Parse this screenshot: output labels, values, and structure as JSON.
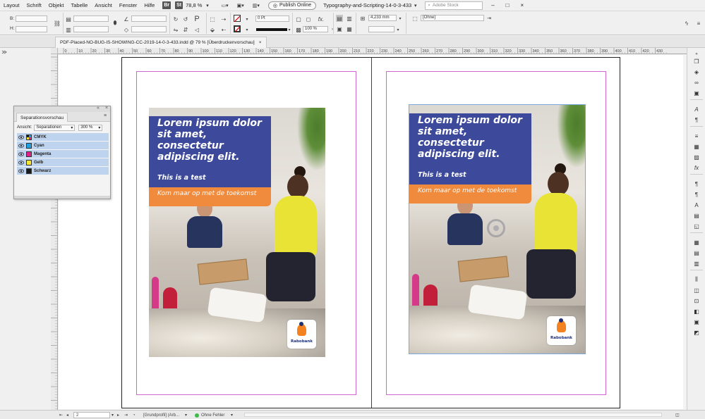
{
  "menu": {
    "items": [
      "Layout",
      "Schrift",
      "Objekt",
      "Tabelle",
      "Ansicht",
      "Fenster",
      "Hilfe"
    ],
    "br_label": "Br",
    "st_label": "St",
    "zoom": "78,8 %",
    "publish_label": "Publish Online",
    "workspace": "Typography-and-Scripting-14-0-3-433",
    "stock_placeholder": "Adobe Stock",
    "win_min": "–",
    "win_max": "□",
    "win_close": "×"
  },
  "control": {
    "b_label": "B:",
    "h_label": "H:",
    "stroke_weight": "0 Pt",
    "opacity": "100 %",
    "offset": "4,233 mm",
    "object_style": "[Ohne]"
  },
  "tab": {
    "title": "PDF-Placed-NO-BUG-IS-SHOWING-CC-2019-14-0-3-433.indd @ 79 % [Überdruckenvorschau]",
    "close": "×"
  },
  "ruler": {
    "h_ticks": [
      "0",
      "10",
      "20",
      "30",
      "40",
      "50",
      "60",
      "70",
      "80",
      "90",
      "100",
      "110",
      "120",
      "130",
      "140",
      "150",
      "160",
      "170",
      "180",
      "190",
      "200",
      "210",
      "220",
      "230",
      "240",
      "250",
      "260",
      "270",
      "280",
      "290",
      "300",
      "310",
      "320",
      "330",
      "340",
      "350",
      "360",
      "370",
      "380",
      "390",
      "400",
      "410",
      "420",
      "430"
    ]
  },
  "page": {
    "headline": "Lorem ipsum dolor sit amet, consectetur adipiscing elit.",
    "subline": "This is a test",
    "tagline": "Kom maar op met de toekomst",
    "logo_text": "Rabobank"
  },
  "panel": {
    "title": "Separationsvorschau",
    "view_label": "Ansicht:",
    "view_value": "Separationen",
    "zoom_value": "300 %",
    "separations": [
      {
        "name": "CMYK",
        "color": "#6a6a6a"
      },
      {
        "name": "Cyan",
        "color": "#1fa3e0"
      },
      {
        "name": "Magenta",
        "color": "#e0218a"
      },
      {
        "name": "Gelb",
        "color": "#f7e733"
      },
      {
        "name": "Schwarz",
        "color": "#1a1a1a"
      }
    ]
  },
  "status": {
    "page_number": "2",
    "profile": "[Grundprofil] (Arb...",
    "errors": "Ohne Fehler"
  },
  "colors": {
    "accent_blue": "#3d4a9b",
    "accent_orange": "#f08a3c",
    "margin_guide": "#d066d0",
    "selection": "#7aa7e0"
  }
}
